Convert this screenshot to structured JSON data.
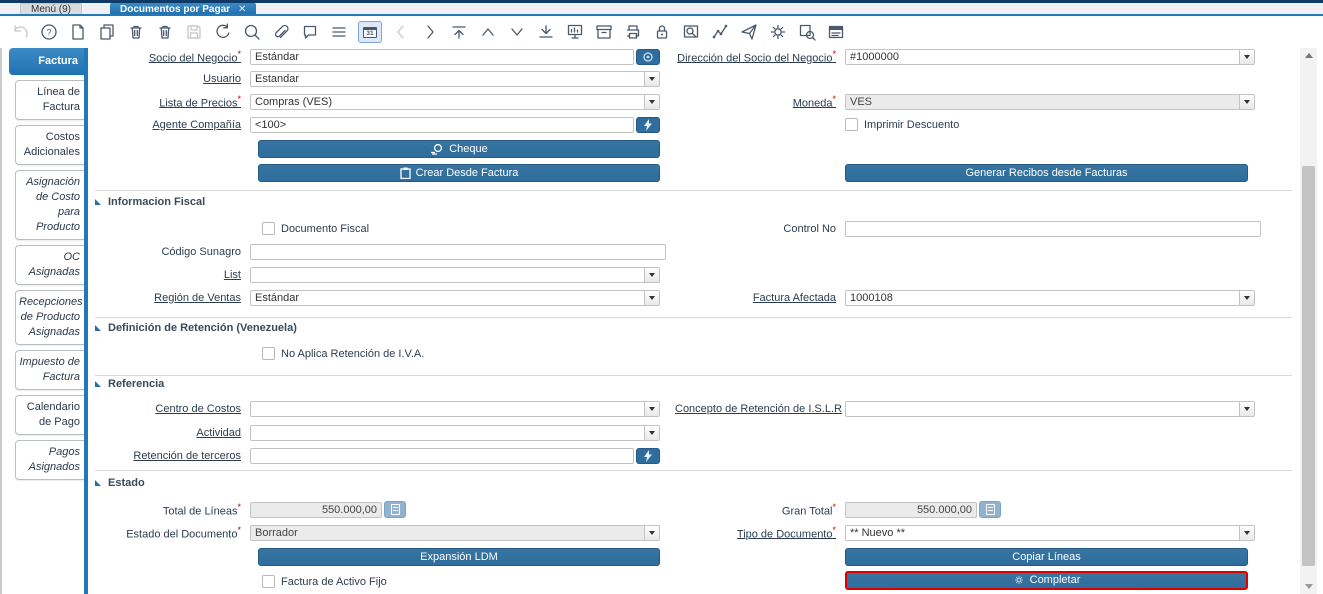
{
  "window": {
    "tabs": [
      {
        "label": "Menú (9)"
      },
      {
        "label": "Documentos por Pagar",
        "active": true
      }
    ],
    "close_icon": "✕"
  },
  "marks": {
    "required": "*"
  },
  "toolbar": {
    "icons": [
      "undo-icon",
      "help-icon",
      "new-record-icon",
      "copy-record-icon",
      "delete-record-icon",
      "delete-selection-icon",
      "save-icon",
      "refresh-icon",
      "find-icon",
      "attachment-icon",
      "chat-icon",
      "grid-toggle-icon",
      "calendar-icon",
      "previous-record-icon",
      "next-record-icon",
      "first-record-icon",
      "parent-record-icon",
      "detail-record-icon",
      "last-record-icon",
      "report-icon",
      "archive-icon",
      "print-icon",
      "lock-icon",
      "zoom-across-icon",
      "workflow-icon",
      "send-mail-icon",
      "process-icon",
      "print-preview-icon",
      "quick-form-icon"
    ],
    "calendar_day": "31"
  },
  "sidebar": {
    "tabs": [
      {
        "label": "Factura",
        "active": true
      },
      {
        "label": "Línea de Factura"
      },
      {
        "label": "Costos Adicionales"
      },
      {
        "label": "Asignación de Costo para Producto",
        "italic": true
      },
      {
        "label": "OC Asignadas",
        "italic": true
      },
      {
        "label": "Recepciones de Producto Asignadas",
        "italic": true
      },
      {
        "label": "Impuesto de Factura",
        "italic": true
      },
      {
        "label": "Calendario de Pago"
      },
      {
        "label": "Pagos Asignados",
        "italic": true
      }
    ]
  },
  "form": {
    "main": {
      "socio": {
        "label": "Socio del Negocio",
        "value": "Estándar"
      },
      "direccion": {
        "label": "Dirección del Socio del Negocio",
        "value": "#1000000"
      },
      "usuario": {
        "label": "Usuario",
        "value": "Estandar"
      },
      "lista_precios": {
        "label": "Lista de Precios",
        "value": "Compras (VES)"
      },
      "moneda": {
        "label": "Moneda",
        "value": "VES"
      },
      "agente": {
        "label": "Agente Compañía",
        "value": "<100>"
      },
      "imprimir_descuento": {
        "label": "Imprimir Descuento",
        "checked": false
      },
      "cheque_btn": "Cheque",
      "crear_btn": "Crear Desde Factura",
      "generar_btn": "Generar Recibos desde Facturas"
    },
    "fiscal": {
      "title": "Informacion Fiscal",
      "documento_fiscal": {
        "label": "Documento Fiscal",
        "checked": false
      },
      "control_no": {
        "label": "Control No",
        "value": ""
      },
      "codigo_sunagro": {
        "label": "Código Sunagro",
        "value": ""
      },
      "list": {
        "label": "List",
        "value": ""
      },
      "region_ventas": {
        "label": "Región de Ventas",
        "value": "Estándar"
      },
      "factura_afectada": {
        "label": "Factura Afectada",
        "value": "1000108"
      }
    },
    "retencion": {
      "title": "Definición de Retención (Venezuela)",
      "no_aplica_iva": {
        "label": "No Aplica Retención de I.V.A.",
        "checked": false
      }
    },
    "referencia": {
      "title": "Referencia",
      "centro_costos": {
        "label": "Centro de Costos",
        "value": ""
      },
      "concepto_islr": {
        "label": "Concepto de Retención de I.S.L.R",
        "value": ""
      },
      "actividad": {
        "label": "Actividad",
        "value": ""
      },
      "retencion_terceros": {
        "label": "Retención de terceros",
        "value": ""
      }
    },
    "estado": {
      "title": "Estado",
      "total_lineas": {
        "label": "Total de Líneas",
        "value": "550.000,00"
      },
      "gran_total": {
        "label": "Gran Total",
        "value": "550.000,00"
      },
      "estado_documento": {
        "label": "Estado del Documento",
        "value": "Borrador"
      },
      "tipo_documento": {
        "label": "Tipo de Documento",
        "value": "** Nuevo **"
      },
      "expansion_btn": "Expansión LDM",
      "copiar_btn": "Copiar Líneas",
      "completar_btn": "Completar",
      "factura_activo_fijo": {
        "label": "Factura de Activo Fijo",
        "checked": false
      }
    }
  },
  "colors": {
    "accent_blue": "#2379b8",
    "button_blue": "#2e6d9e",
    "highlight_red": "#dd0000",
    "required_red": "#cc0000",
    "topstrip_navy": "#0f3a66"
  }
}
